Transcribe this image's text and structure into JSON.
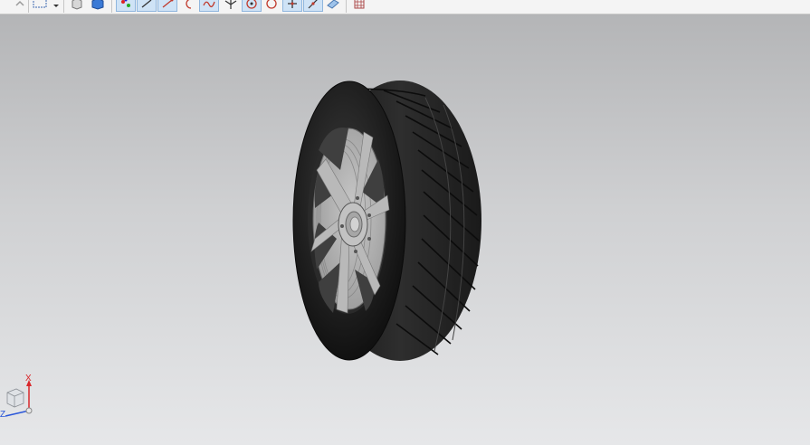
{
  "toolbar": {
    "buttons": [
      {
        "name": "undo-icon"
      },
      {
        "name": "select-box-icon"
      },
      {
        "name": "static-wireframe-icon"
      },
      {
        "name": "shaded-view-icon"
      },
      {
        "name": "snap-point-icon"
      },
      {
        "name": "line-icon"
      },
      {
        "name": "curve-icon"
      },
      {
        "name": "arc-icon"
      },
      {
        "name": "spline-icon"
      },
      {
        "name": "intersection-icon"
      },
      {
        "name": "center-point-icon"
      },
      {
        "name": "quadrant-point-icon"
      },
      {
        "name": "point-on-curve-icon"
      },
      {
        "name": "midpoint-icon"
      },
      {
        "name": "face-icon"
      },
      {
        "name": "grid-icon"
      }
    ]
  },
  "viewport": {
    "model": "tire-wheel-model",
    "background_top": "#b4b5b7",
    "background_bottom": "#e6e7e9"
  },
  "triad": {
    "x_label": "X",
    "z_label": "Z",
    "x_color": "#d9262a",
    "z_color": "#2a56d9"
  }
}
